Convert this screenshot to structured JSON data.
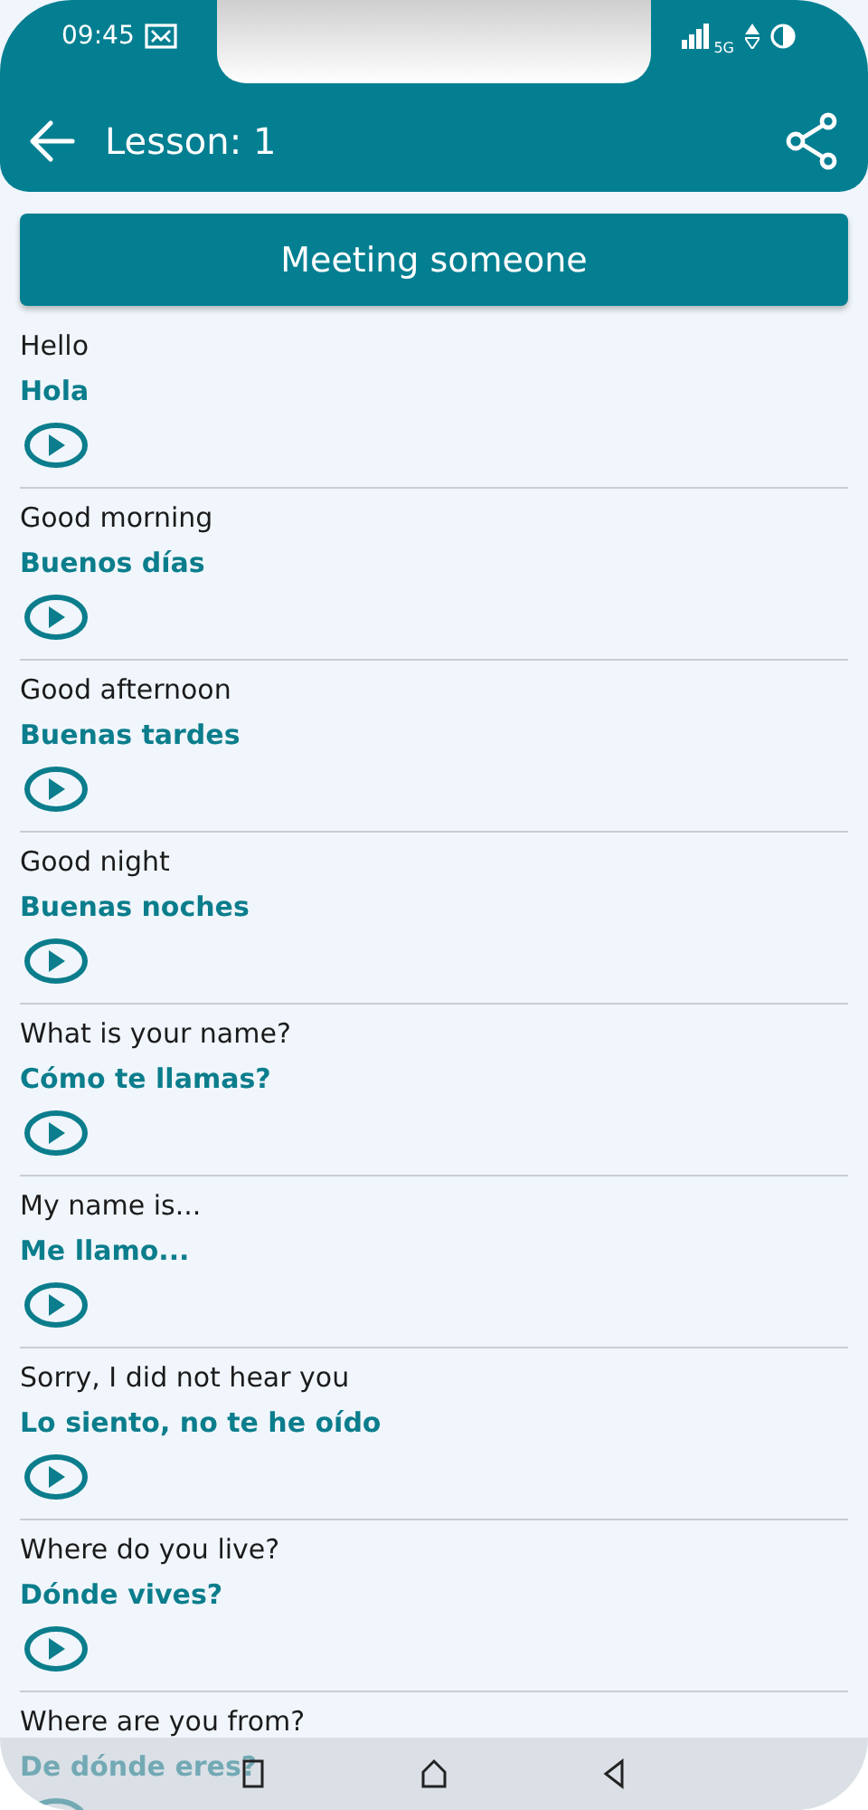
{
  "status_bar": {
    "time": "09:45",
    "network": "5G"
  },
  "header": {
    "title": "Lesson: 1"
  },
  "section": {
    "title": "Meeting someone"
  },
  "phrases": [
    {
      "english": "Hello",
      "spanish": "Hola"
    },
    {
      "english": "Good morning",
      "spanish": "Buenos días"
    },
    {
      "english": "Good afternoon",
      "spanish": "Buenas tardes"
    },
    {
      "english": "Good night",
      "spanish": "Buenas noches"
    },
    {
      "english": "What is your name?",
      "spanish": "Cómo te llamas?"
    },
    {
      "english": "My name is...",
      "spanish": "Me llamo..."
    },
    {
      "english": "Sorry, I did not hear you",
      "spanish": "Lo siento, no te he oído"
    },
    {
      "english": "Where do you live?",
      "spanish": "Dónde vives?"
    },
    {
      "english": "Where are you from?",
      "spanish": "De dónde eres?"
    }
  ]
}
